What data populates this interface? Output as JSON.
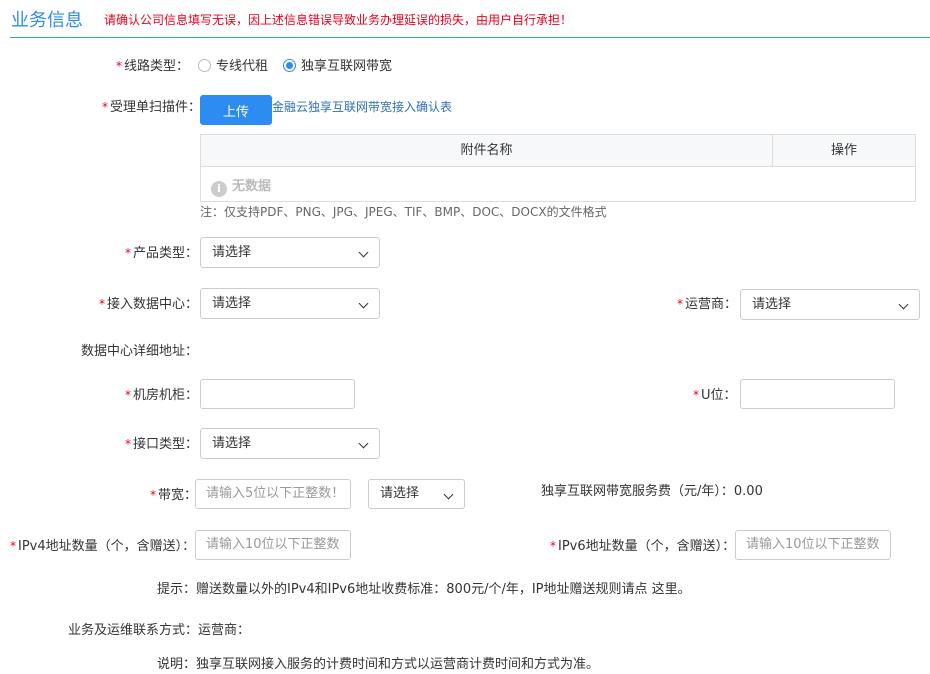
{
  "header": {
    "title": "业务信息",
    "warning": "请确认公司信息填写无误，因上述信息错误导致业务办理延误的损失，由用户自行承担！"
  },
  "required_mark": "*",
  "line_type": {
    "label": "线路类型：",
    "options": [
      {
        "label": "专线代租",
        "checked": false
      },
      {
        "label": "独享互联网带宽",
        "checked": true
      }
    ]
  },
  "scan": {
    "label": "受理单扫描件：",
    "upload_label": "上传",
    "link_text": "金融云独享互联网带宽接入确认表"
  },
  "attachments": {
    "col_name": "附件名称",
    "col_action": "操作",
    "empty_icon": "i",
    "empty_text": "无数据",
    "note": "注：仅支持PDF、PNG、JPG、JPEG、TIF、BMP、DOC、DOCX的文件格式"
  },
  "product_type": {
    "label": "产品类型：",
    "value": "请选择"
  },
  "data_center": {
    "label": "接入数据中心：",
    "value": "请选择"
  },
  "operator": {
    "label": "运营商：",
    "value": "请选择"
  },
  "dc_address": {
    "label": "数据中心详细地址："
  },
  "cabinet": {
    "label": "机房机柜：",
    "value": ""
  },
  "u_position": {
    "label": "U位：",
    "value": ""
  },
  "interface_type": {
    "label": "接口类型：",
    "value": "请选择"
  },
  "bandwidth": {
    "label": "带宽：",
    "placeholder": "请输入5位以下正整数！",
    "unit_value": "请选择"
  },
  "service_fee": {
    "label": "独享互联网带宽服务费（元/年）：",
    "value": "0.00"
  },
  "ipv4": {
    "label": "IPv4地址数量（个，含赠送）：",
    "placeholder": "请输入10位以下正整数"
  },
  "ipv6": {
    "label": "IPv6地址数量（个，含赠送）：",
    "placeholder": "请输入10位以下正整数"
  },
  "hint": "提示：赠送数量以外的IPv4和IPv6地址收费标准：800元/个/年，IP地址赠送规则请点 这里。",
  "contact": {
    "label": "业务及运维联系方式：",
    "value": "运营商："
  },
  "explain": "说明：独享互联网接入服务的计费时间和方式以运营商计费时间和方式为准。",
  "colors": {
    "accent": "#2d8cf0",
    "required": "#e8001c",
    "link": "#2d6fb8"
  }
}
